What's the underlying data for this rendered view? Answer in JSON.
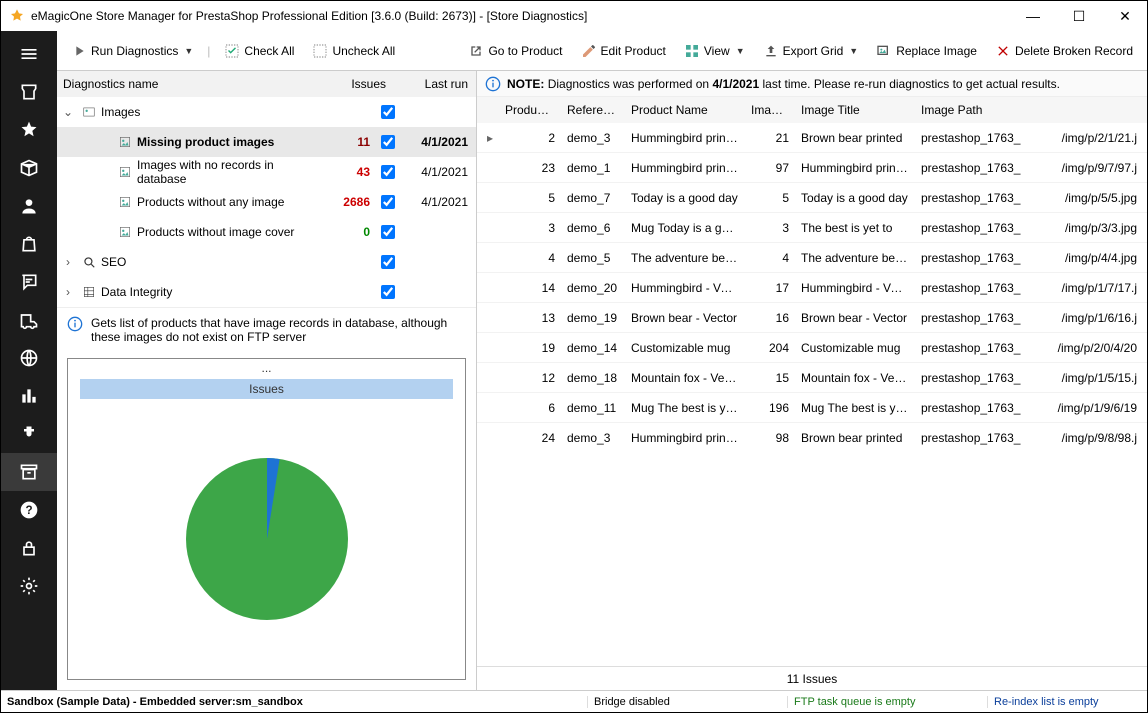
{
  "title": "eMagicOne Store Manager for PrestaShop Professional Edition [3.6.0 (Build: 2673)] - [Store Diagnostics]",
  "wincontrols": {
    "min": "—",
    "max": "☐",
    "close": "✕"
  },
  "toolbar": {
    "run": "Run Diagnostics",
    "check_all": "Check All",
    "uncheck_all": "Uncheck All",
    "go_to_product": "Go to Product",
    "edit_product": "Edit Product",
    "view": "View",
    "export_grid": "Export Grid",
    "replace_image": "Replace Image",
    "delete_broken": "Delete Broken Record"
  },
  "leftbar_icons": [
    "menu",
    "store",
    "star",
    "package",
    "user",
    "bag",
    "chat",
    "truck",
    "globe",
    "chart",
    "plugin",
    "archive",
    "help",
    "lock",
    "gear"
  ],
  "diag_header": {
    "name": "Diagnostics name",
    "issues": "Issues",
    "last": "Last run"
  },
  "diag_tree": {
    "images": {
      "label": "Images",
      "expanded": true,
      "children": [
        {
          "label": "Missing product images",
          "issues": "11",
          "cls": "count-darkred",
          "last": "4/1/2021",
          "checked": true,
          "selected": true
        },
        {
          "label": "Images with no records in database",
          "issues": "43",
          "cls": "count-red",
          "last": "4/1/2021",
          "checked": true
        },
        {
          "label": "Products without any image",
          "issues": "2686",
          "cls": "count-red",
          "last": "4/1/2021",
          "checked": true
        },
        {
          "label": "Products without image cover",
          "issues": "0",
          "cls": "count-green",
          "last": "",
          "checked": true
        }
      ]
    },
    "seo": {
      "label": "SEO",
      "expanded": false,
      "checked": true
    },
    "integrity": {
      "label": "Data Integrity",
      "expanded": false,
      "checked": true
    }
  },
  "info_text": "Gets list of products that have image records in database, although these images do not exist on FTP server",
  "chart": {
    "title": "Issues",
    "ellipsis": "..."
  },
  "note": {
    "label": "NOTE:",
    "pre": "Diagnostics was performed on ",
    "date": "4/1/2021",
    "post": " last time. Please re-run diagnostics to get actual results."
  },
  "grid_header": [
    "Product ID",
    "Reference",
    "Product Name",
    "Image ID",
    "Image Title",
    "Image Path",
    ""
  ],
  "grid_rows": [
    {
      "pid": "2",
      "ref": "demo_3",
      "pname": "Hummingbird printed",
      "iid": "21",
      "ititle": "Brown bear printed",
      "ipath": "prestashop_1763_",
      "ip2": "/img/p/2/1/21.j",
      "arrow": true
    },
    {
      "pid": "23",
      "ref": "demo_1",
      "pname": "Hummingbird printed",
      "iid": "97",
      "ititle": "Hummingbird printed",
      "ipath": "prestashop_1763_",
      "ip2": "/img/p/9/7/97.j"
    },
    {
      "pid": "5",
      "ref": "demo_7",
      "pname": "Today is a good day",
      "iid": "5",
      "ititle": "Today is a good day",
      "ipath": "prestashop_1763_",
      "ip2": "/img/p/5/5.jpg"
    },
    {
      "pid": "3",
      "ref": "demo_6",
      "pname": "Mug Today is a good",
      "iid": "3",
      "ititle": "The best is yet to",
      "ipath": "prestashop_1763_",
      "ip2": "/img/p/3/3.jpg"
    },
    {
      "pid": "4",
      "ref": "demo_5",
      "pname": "The adventure begins",
      "iid": "4",
      "ititle": "The adventure begins",
      "ipath": "prestashop_1763_",
      "ip2": "/img/p/4/4.jpg"
    },
    {
      "pid": "14",
      "ref": "demo_20",
      "pname": "Hummingbird - Vector",
      "iid": "17",
      "ititle": "Hummingbird - Vector",
      "ipath": "prestashop_1763_",
      "ip2": "/img/p/1/7/17.j"
    },
    {
      "pid": "13",
      "ref": "demo_19",
      "pname": "Brown bear - Vector",
      "iid": "16",
      "ititle": "Brown bear - Vector",
      "ipath": "prestashop_1763_",
      "ip2": "/img/p/1/6/16.j"
    },
    {
      "pid": "19",
      "ref": "demo_14",
      "pname": "Customizable mug",
      "iid": "204",
      "ititle": "Customizable mug",
      "ipath": "prestashop_1763_",
      "ip2": "/img/p/2/0/4/20"
    },
    {
      "pid": "12",
      "ref": "demo_18",
      "pname": "Mountain fox - Vector",
      "iid": "15",
      "ititle": "Mountain fox - Vector",
      "ipath": "prestashop_1763_",
      "ip2": "/img/p/1/5/15.j"
    },
    {
      "pid": "6",
      "ref": "demo_11",
      "pname": "Mug The best is yet to",
      "iid": "196",
      "ititle": "Mug The best is yet to",
      "ipath": "prestashop_1763_",
      "ip2": "/img/p/1/9/6/19"
    },
    {
      "pid": "24",
      "ref": "demo_3",
      "pname": "Hummingbird printed",
      "iid": "98",
      "ititle": "Brown bear printed",
      "ipath": "prestashop_1763_",
      "ip2": "/img/p/9/8/98.j"
    }
  ],
  "grid_footer": "11 Issues",
  "statusbar": {
    "left": "Sandbox (Sample Data) - Embedded server:sm_sandbox",
    "bridge": "Bridge disabled",
    "queue": "FTP task queue is empty",
    "reindex": "Re-index list is empty"
  },
  "chart_data": {
    "type": "pie",
    "series": [
      {
        "name": "Issues",
        "values": [
          {
            "label": "slice-blue",
            "value": 3,
            "color": "#1e73d4"
          },
          {
            "label": "slice-green",
            "value": 97,
            "color": "#3da648"
          }
        ]
      }
    ],
    "title": "Issues"
  }
}
